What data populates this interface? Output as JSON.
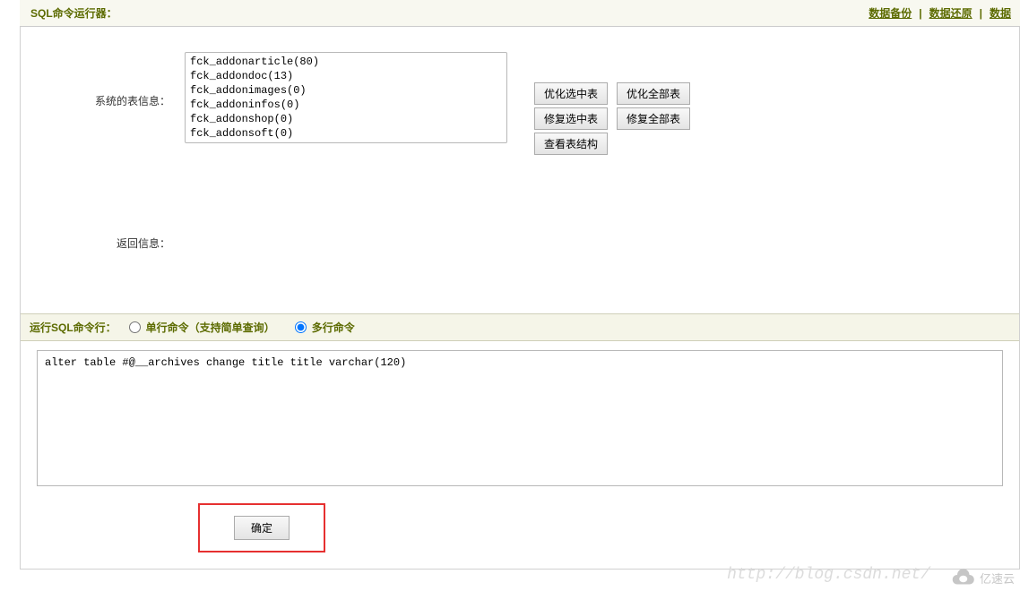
{
  "header": {
    "title": "SQL命令运行器：",
    "links": {
      "backup": "数据备份",
      "restore": "数据还原",
      "extra": "数据"
    }
  },
  "tableInfo": {
    "label": "系统的表信息：",
    "options": [
      "fck_addonarticle(80)",
      "fck_addondoc(13)",
      "fck_addonimages(0)",
      "fck_addoninfos(0)",
      "fck_addonshop(0)",
      "fck_addonsoft(0)"
    ]
  },
  "buttons": {
    "optimizeSelected": "优化选中表",
    "optimizeAll": "优化全部表",
    "repairSelected": "修复选中表",
    "repairAll": "修复全部表",
    "viewStructure": "查看表结构"
  },
  "returnInfo": {
    "label": "返回信息："
  },
  "sqlMode": {
    "label": "运行SQL命令行：",
    "single": "单行命令（支持简单查询）",
    "multi": "多行命令"
  },
  "sqlInput": {
    "value": "alter table #@__archives change title title varchar(120)"
  },
  "submit": {
    "label": "确定"
  },
  "watermark": {
    "url": "http://blog.csdn.net/",
    "logoText": "亿速云"
  }
}
